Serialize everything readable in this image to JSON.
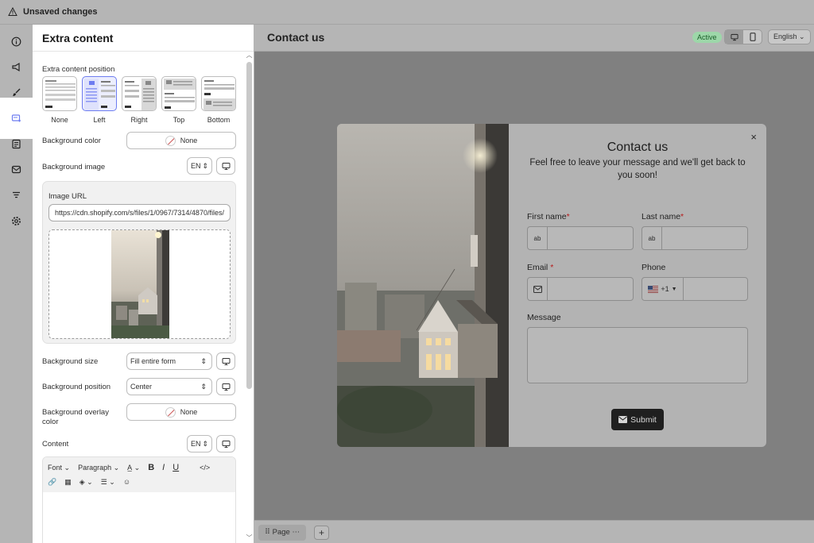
{
  "topbar": {
    "status": "Unsaved changes"
  },
  "rail": {
    "icons": [
      "info-icon",
      "megaphone-icon",
      "brush-icon",
      "extra-content-icon",
      "document-icon",
      "mail-icon",
      "filter-icon",
      "settings-icon"
    ]
  },
  "panel": {
    "title": "Extra content",
    "position_label": "Extra content position",
    "positions": [
      "None",
      "Left",
      "Right",
      "Top",
      "Bottom"
    ],
    "selected_position": "Left",
    "bg_color_label": "Background color",
    "bg_color_value": "None",
    "bg_image_label": "Background image",
    "lang_code": "EN",
    "image_url_label": "Image URL",
    "image_url": "https://cdn.shopify.com/s/files/1/0967/7314/4870/files/",
    "bg_size_label": "Background size",
    "bg_size_value": "Fill entire form",
    "bg_position_label": "Background position",
    "bg_position_value": "Center",
    "bg_overlay_label": "Background overlay color",
    "bg_overlay_value": "None",
    "content_label": "Content",
    "content_lang": "EN",
    "toolbar": {
      "font": "Font",
      "paragraph": "Paragraph"
    }
  },
  "canvas": {
    "title": "Contact us",
    "badge": "Active",
    "language": "English"
  },
  "form": {
    "title": "Contact us",
    "subtitle": "Feel free to leave your message and we'll get back to you soon!",
    "first_name": "First name",
    "last_name": "Last name",
    "email": "Email",
    "phone": "Phone",
    "phone_code": "+1",
    "message": "Message",
    "submit": "Submit",
    "required_mark": "*",
    "close": "×"
  },
  "bottombar": {
    "page": "Page",
    "add": "+"
  },
  "colors": {
    "accent": "#6d7cf0",
    "active_badge": "#9dd7a9",
    "submit_bg": "#1f1f1f"
  }
}
